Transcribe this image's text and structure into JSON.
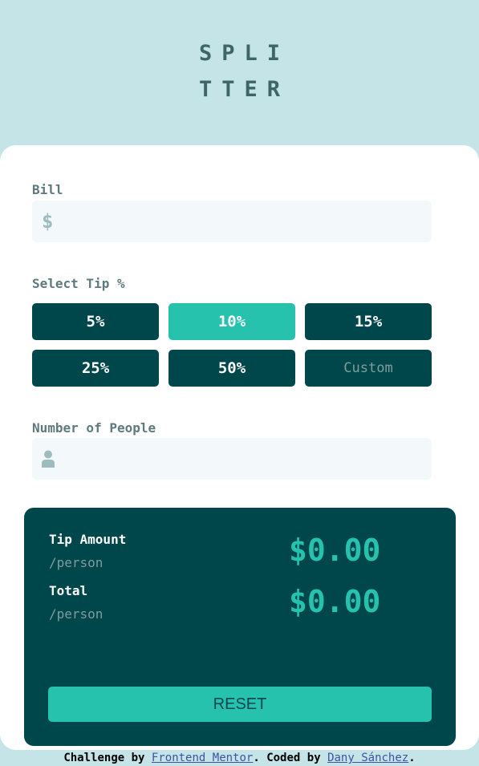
{
  "logo": {
    "line1": "SPLI",
    "line2": "TTER"
  },
  "bill": {
    "label": "Bill",
    "currency_symbol": "$",
    "value": "",
    "placeholder": ""
  },
  "tip": {
    "label": "Select Tip %",
    "options": [
      "5%",
      "10%",
      "15%",
      "25%",
      "50%"
    ],
    "selected": "10%",
    "custom_placeholder": "Custom"
  },
  "people": {
    "label": "Number of People",
    "icon": "person-icon",
    "value": "",
    "placeholder": ""
  },
  "results": {
    "tip_amount_label": "Tip Amount",
    "tip_amount_sub": "/person",
    "tip_amount_value": "$0.00",
    "total_label": "Total",
    "total_sub": "/person",
    "total_value": "$0.00",
    "reset_label": "RESET"
  },
  "footer": {
    "prefix": "Challenge by",
    "link1": "Frontend Mentor",
    "middle": ". Coded by",
    "link2": "Dany Sánchez",
    "suffix": "."
  },
  "colors": {
    "background": "#c5e4e7",
    "dark_cyan": "#00474b",
    "accent": "#26c2ae",
    "input_bg": "#f3f9fa",
    "label_grey": "#5e7a7d"
  }
}
